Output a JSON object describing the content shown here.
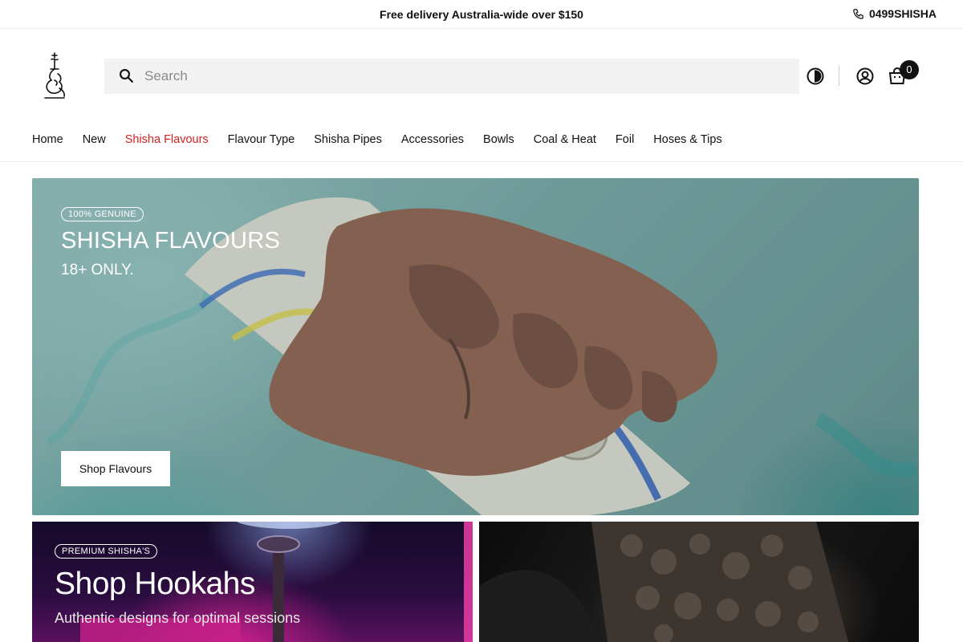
{
  "announcement": {
    "text": "Free delivery Australia-wide over $150"
  },
  "contact": {
    "phone": "0499SHISHA",
    "icon": "phone-icon"
  },
  "header": {
    "logo_icon": "hookah-logo-icon",
    "search": {
      "placeholder": "Search",
      "value": "",
      "icon": "search-icon"
    },
    "icons": [
      "theme-toggle-icon",
      "account-icon",
      "cart-icon"
    ],
    "cart_count": "0"
  },
  "nav": {
    "items": [
      {
        "label": "Home"
      },
      {
        "label": "New"
      },
      {
        "label": "Shisha Flavours",
        "active": true
      },
      {
        "label": "Flavour Type"
      },
      {
        "label": "Shisha Pipes"
      },
      {
        "label": "Accessories"
      },
      {
        "label": "Bowls"
      },
      {
        "label": "Coal & Heat"
      },
      {
        "label": "Foil"
      },
      {
        "label": "Hoses & Tips"
      }
    ],
    "active_color": "#d21f1f"
  },
  "hero": {
    "badge": "100% GENUINE",
    "title": "SHISHA FLAVOURS",
    "subtitle": "18+ ONLY.",
    "cta": "Shop Flavours"
  },
  "cards": [
    {
      "badge": "PREMIUM SHISHA'S",
      "title": "Shop Hookahs",
      "subtitle": "Authentic designs for optimal sessions"
    },
    {
      "badge": "",
      "title": "",
      "subtitle": ""
    }
  ]
}
